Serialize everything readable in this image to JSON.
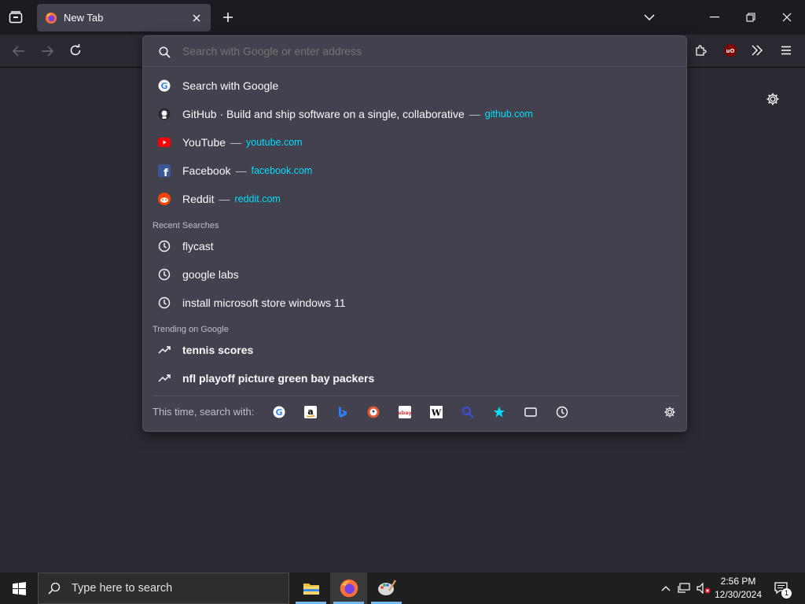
{
  "tab": {
    "title": "New Tab"
  },
  "urlbar": {
    "placeholder": "Search with Google or enter address"
  },
  "suggestions": [
    {
      "title": "Search with Google",
      "icon": "google-icon"
    },
    {
      "title": "GitHub · Build and ship software on a single, collaborative",
      "url": "github.com",
      "icon": "github-icon"
    },
    {
      "title": "YouTube",
      "url": "youtube.com",
      "icon": "youtube-icon"
    },
    {
      "title": "Facebook",
      "url": "facebook.com",
      "icon": "facebook-icon"
    },
    {
      "title": "Reddit",
      "url": "reddit.com",
      "icon": "reddit-icon"
    }
  ],
  "recent": {
    "label": "Recent Searches",
    "items": [
      "flycast",
      "google labs",
      "install microsoft store windows 11"
    ]
  },
  "trending": {
    "label": "Trending on Google",
    "items": [
      "tennis scores",
      "nfl playoff picture green bay packers"
    ]
  },
  "oneoff": {
    "label": "This time, search with:",
    "engines": [
      "google-icon",
      "amazon-icon",
      "bing-icon",
      "duckduckgo-icon",
      "ebay-icon",
      "wikipedia-icon",
      "search-icon",
      "bookmarks-icon",
      "tabs-icon",
      "history-icon"
    ]
  },
  "taskbar": {
    "search_placeholder": "Type here to search",
    "time": "2:56 PM",
    "date": "12/30/2024",
    "notification_count": "1"
  },
  "separator": "—",
  "colors": {
    "url": "#00ddff",
    "popup": "#42414d",
    "toolbar": "#2b2a33",
    "ublock": "#800000"
  }
}
